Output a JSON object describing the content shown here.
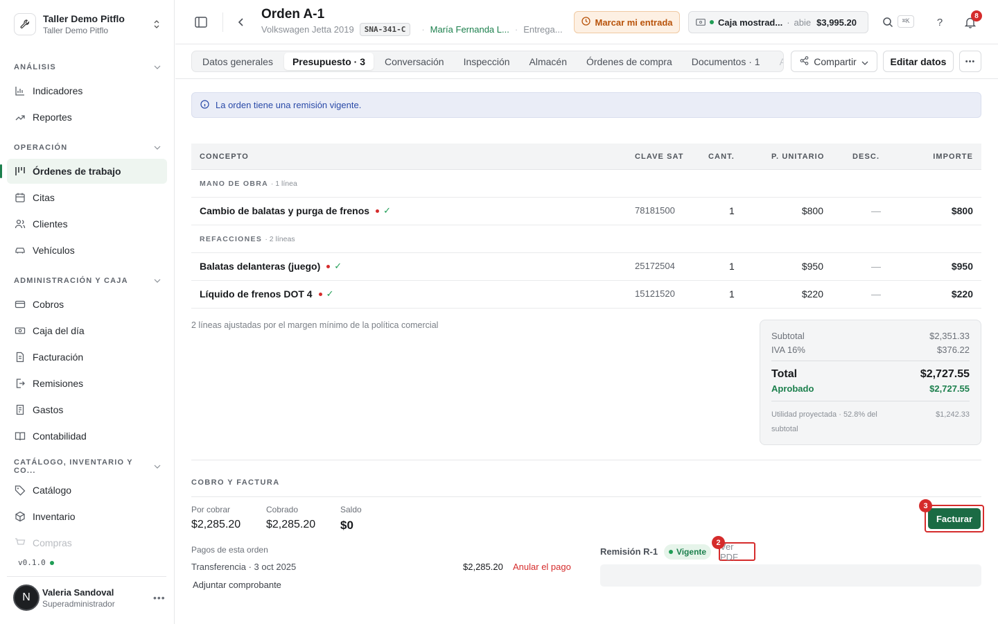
{
  "org": {
    "name": "Taller Demo Pitflo",
    "sub": "Taller Demo Pitflo"
  },
  "sidebar": {
    "sections": [
      {
        "label": "ANÁLISIS"
      },
      {
        "label": "OPERACIÓN"
      },
      {
        "label": "ADMINISTRACIÓN Y CAJA"
      },
      {
        "label": "CATÁLOGO, INVENTARIO Y CO..."
      }
    ],
    "items": [
      {
        "label": "Indicadores",
        "icon": "bar-chart-icon"
      },
      {
        "label": "Reportes",
        "icon": "trend-icon"
      },
      {
        "label": "Órdenes de trabajo",
        "icon": "kanban-icon",
        "active": true
      },
      {
        "label": "Citas",
        "icon": "calendar-icon"
      },
      {
        "label": "Clientes",
        "icon": "users-icon"
      },
      {
        "label": "Vehículos",
        "icon": "car-icon"
      },
      {
        "label": "Cobros",
        "icon": "card-icon"
      },
      {
        "label": "Caja del día",
        "icon": "cash-icon"
      },
      {
        "label": "Facturación",
        "icon": "invoice-icon"
      },
      {
        "label": "Remisiones",
        "icon": "export-icon"
      },
      {
        "label": "Gastos",
        "icon": "receipt-icon"
      },
      {
        "label": "Contabilidad",
        "icon": "book-icon"
      },
      {
        "label": "Catálogo",
        "icon": "tag-icon"
      },
      {
        "label": "Inventario",
        "icon": "box-icon"
      },
      {
        "label": "Compras",
        "icon": "cart-icon"
      }
    ],
    "version": "v0.1.0",
    "user": {
      "initial": "N",
      "name": "Valeria Sandoval",
      "role": "Superadministrador"
    }
  },
  "header": {
    "title": "Orden A-1",
    "vehicle": "Volkswagen Jetta 2019",
    "plate": "SNA-341-C",
    "customer": "María Fernanda L...",
    "status": "Entrega...",
    "entry_button": "Marcar mi entrada",
    "register": {
      "name": "Caja mostrad...",
      "state": "abie",
      "amount": "$3,995.20"
    },
    "shortcut": "⌘K",
    "notifications": "8"
  },
  "tabs": [
    {
      "label": "Datos generales"
    },
    {
      "label": "Presupuesto · 3",
      "active": true
    },
    {
      "label": "Conversación"
    },
    {
      "label": "Inspección"
    },
    {
      "label": "Almacén"
    },
    {
      "label": "Órdenes de compra"
    },
    {
      "label": "Documentos · 1"
    },
    {
      "label": "Ad"
    }
  ],
  "actions": {
    "share": "Compartir",
    "edit": "Editar datos"
  },
  "notice": "La orden tiene una remisión vigente.",
  "table": {
    "headers": {
      "concept": "CONCEPTO",
      "clave": "CLAVE SAT",
      "cant": "CANT.",
      "punit": "P. UNITARIO",
      "desc": "DESC.",
      "importe": "IMPORTE"
    },
    "groups": [
      {
        "label": "MANO DE OBRA",
        "count": "· 1 línea",
        "rows": [
          {
            "concept": "Cambio de balatas y purga de frenos",
            "clave": "78181500",
            "cant": "1",
            "punit": "$800",
            "desc": "—",
            "importe": "$800"
          }
        ]
      },
      {
        "label": "REFACCIONES",
        "count": "· 2 líneas",
        "rows": [
          {
            "concept": "Balatas delanteras (juego)",
            "clave": "25172504",
            "cant": "1",
            "punit": "$950",
            "desc": "—",
            "importe": "$950"
          },
          {
            "concept": "Líquido de frenos DOT 4",
            "clave": "15121520",
            "cant": "1",
            "punit": "$220",
            "desc": "—",
            "importe": "$220"
          }
        ]
      }
    ],
    "adjust_note": "2 líneas ajustadas por el margen mínimo de la política comercial"
  },
  "totals": {
    "subtotal_label": "Subtotal",
    "subtotal": "$2,351.33",
    "iva_label": "IVA 16%",
    "iva": "$376.22",
    "total_label": "Total",
    "total": "$2,727.55",
    "approved_label": "Aprobado",
    "approved": "$2,727.55",
    "util_label": "Utilidad proyectada · 52.8% del subtotal",
    "util": "$1,242.33"
  },
  "billing": {
    "section_label": "COBRO Y FACTURA",
    "por_cobrar_label": "Por cobrar",
    "por_cobrar": "$2,285.20",
    "cobrado_label": "Cobrado",
    "cobrado": "$2,285.20",
    "saldo_label": "Saldo",
    "saldo": "$0",
    "payments_label": "Pagos de esta orden",
    "payment": {
      "desc": "Transferencia · 3 oct 2025",
      "amount": "$2,285.20",
      "void": "Anular el pago"
    },
    "attach": "Adjuntar comprobante",
    "remision": {
      "label": "Remisión R-1",
      "status": "Vigente",
      "view_pdf": "Ver PDF"
    },
    "invoice_button": "Facturar"
  },
  "markers": {
    "m2": "2",
    "m3": "3"
  },
  "colors": {
    "accent": "#1b7f4c",
    "danger": "#d52b2b",
    "notice": "#2a4aa8"
  }
}
